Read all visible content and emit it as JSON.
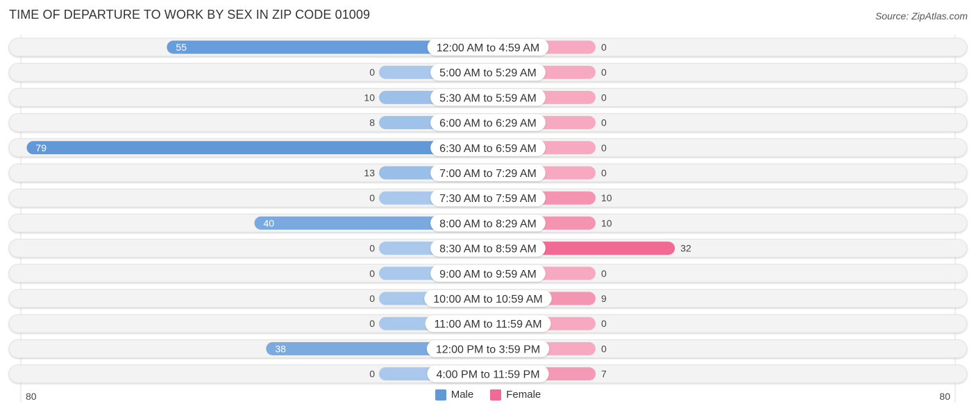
{
  "header": {
    "title": "TIME OF DEPARTURE TO WORK BY SEX IN ZIP CODE 01009",
    "source": "Source: ZipAtlas.com"
  },
  "colors": {
    "male": "#6199d8",
    "male_light": "#a9c8eb",
    "female": "#f06a93",
    "female_light": "#f6a9c0",
    "row_bg": "#f3f3f3",
    "label_bg": "#ffffff"
  },
  "legend": {
    "male_label": "Male",
    "female_label": "Female"
  },
  "axis": {
    "left_label": "80",
    "right_label": "80"
  },
  "chart_data": {
    "type": "bar",
    "orientation": "horizontal-diverging",
    "title": "TIME OF DEPARTURE TO WORK BY SEX IN ZIP CODE 01009",
    "xlabel": "",
    "ylabel": "",
    "xlim": [
      -80,
      80
    ],
    "legend_position": "bottom-center",
    "categories": [
      "12:00 AM to 4:59 AM",
      "5:00 AM to 5:29 AM",
      "5:30 AM to 5:59 AM",
      "6:00 AM to 6:29 AM",
      "6:30 AM to 6:59 AM",
      "7:00 AM to 7:29 AM",
      "7:30 AM to 7:59 AM",
      "8:00 AM to 8:29 AM",
      "8:30 AM to 8:59 AM",
      "9:00 AM to 9:59 AM",
      "10:00 AM to 10:59 AM",
      "11:00 AM to 11:59 AM",
      "12:00 PM to 3:59 PM",
      "4:00 PM to 11:59 PM"
    ],
    "series": [
      {
        "name": "Male",
        "side": "left",
        "values": [
          55,
          0,
          10,
          8,
          79,
          13,
          0,
          40,
          0,
          0,
          0,
          0,
          38,
          0
        ]
      },
      {
        "name": "Female",
        "side": "right",
        "values": [
          0,
          0,
          0,
          0,
          0,
          0,
          10,
          10,
          32,
          0,
          9,
          0,
          0,
          7
        ]
      }
    ]
  }
}
